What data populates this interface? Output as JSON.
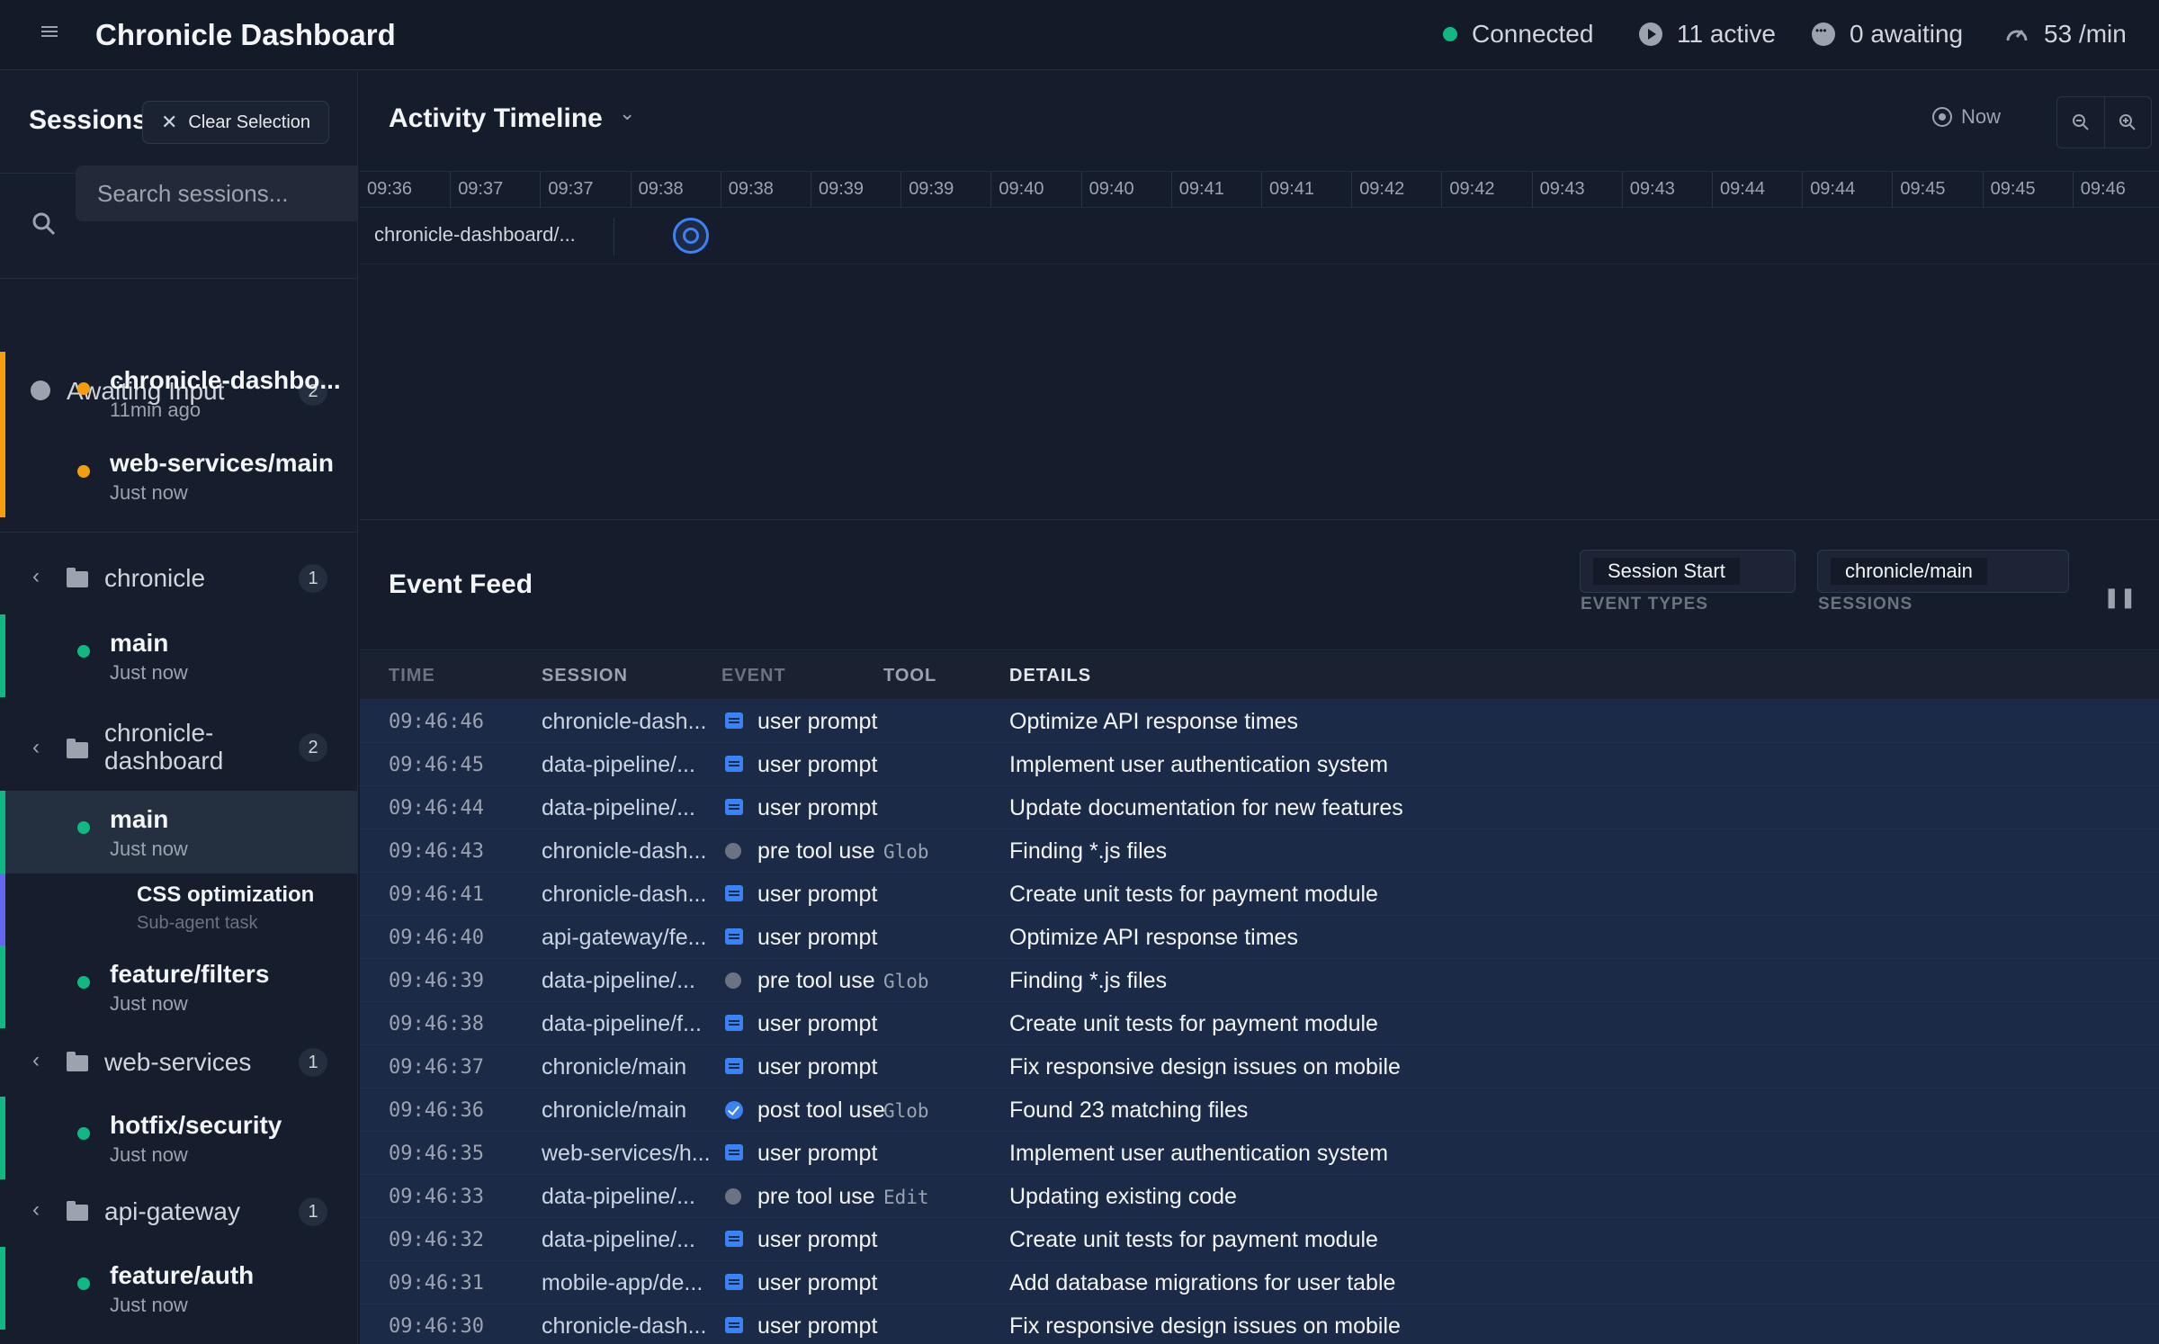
{
  "header": {
    "title": "Chronicle Dashboard",
    "status": "Connected",
    "active": "11 active",
    "awaiting": "0 awaiting",
    "rate": "53 /min"
  },
  "sidebar": {
    "title": "Sessions",
    "clear_label": "Clear Selection",
    "search_placeholder": "Search sessions...",
    "awaiting": {
      "label": "Awaiting Input",
      "count": "2",
      "items": [
        {
          "name": "chronicle-dashbo...",
          "time": "11min ago"
        },
        {
          "name": "web-services/main",
          "time": "Just now"
        }
      ]
    },
    "groups": [
      {
        "name": "chronicle",
        "count": "1",
        "items": [
          {
            "name": "main",
            "time": "Just now"
          }
        ]
      },
      {
        "name_line1": "chronicle-",
        "name_line2": "dashboard",
        "count": "2",
        "items": [
          {
            "name": "main",
            "time": "Just now",
            "sub": {
              "name": "CSS optimization",
              "label": "Sub-agent task"
            }
          },
          {
            "name": "feature/filters",
            "time": "Just now"
          }
        ]
      },
      {
        "name": "web-services",
        "count": "1",
        "items": [
          {
            "name": "hotfix/security",
            "time": "Just now"
          }
        ]
      },
      {
        "name": "api-gateway",
        "count": "1",
        "items": [
          {
            "name": "feature/auth",
            "time": "Just now"
          }
        ]
      }
    ]
  },
  "timeline": {
    "title": "Activity Timeline",
    "now_label": "Now",
    "ticks": [
      "09:36",
      "09:37",
      "09:37",
      "09:38",
      "09:38",
      "09:39",
      "09:39",
      "09:40",
      "09:40",
      "09:41",
      "09:41",
      "09:42",
      "09:42",
      "09:43",
      "09:43",
      "09:44",
      "09:44",
      "09:45",
      "09:45",
      "09:46"
    ],
    "row_label": "chronicle-dashboard/..."
  },
  "feed": {
    "title": "Event Feed",
    "filter_event_value": "Session Start",
    "filter_event_caption": "EVENT TYPES",
    "filter_session_value": "chronicle/main",
    "filter_session_caption": "SESSIONS",
    "pause_icon": "pause-icon",
    "columns": {
      "time": "TIME",
      "session": "SESSION",
      "event": "EVENT",
      "tool": "TOOL",
      "details": "DETAILS"
    },
    "rows": [
      {
        "time": "09:46:46",
        "session": "chronicle-dash...",
        "event_type": "prompt",
        "event": "user prompt",
        "tool": "",
        "details": "Optimize API response times"
      },
      {
        "time": "09:46:45",
        "session": "data-pipeline/...",
        "event_type": "prompt",
        "event": "user prompt",
        "tool": "",
        "details": "Implement user authentication system"
      },
      {
        "time": "09:46:44",
        "session": "data-pipeline/...",
        "event_type": "prompt",
        "event": "user prompt",
        "tool": "",
        "details": "Update documentation for new features"
      },
      {
        "time": "09:46:43",
        "session": "chronicle-dash...",
        "event_type": "pre",
        "event": "pre tool use",
        "tool": "Glob",
        "details": "Finding *.js files"
      },
      {
        "time": "09:46:41",
        "session": "chronicle-dash...",
        "event_type": "prompt",
        "event": "user prompt",
        "tool": "",
        "details": "Create unit tests for payment module"
      },
      {
        "time": "09:46:40",
        "session": "api-gateway/fe...",
        "event_type": "prompt",
        "event": "user prompt",
        "tool": "",
        "details": "Optimize API response times"
      },
      {
        "time": "09:46:39",
        "session": "data-pipeline/...",
        "event_type": "pre",
        "event": "pre tool use",
        "tool": "Glob",
        "details": "Finding *.js files"
      },
      {
        "time": "09:46:38",
        "session": "data-pipeline/f...",
        "event_type": "prompt",
        "event": "user prompt",
        "tool": "",
        "details": "Create unit tests for payment module"
      },
      {
        "time": "09:46:37",
        "session": "chronicle/main",
        "event_type": "prompt",
        "event": "user prompt",
        "tool": "",
        "details": "Fix responsive design issues on mobile"
      },
      {
        "time": "09:46:36",
        "session": "chronicle/main",
        "event_type": "post",
        "event": "post tool use",
        "tool": "Glob",
        "details": "Found 23 matching files"
      },
      {
        "time": "09:46:35",
        "session": "web-services/h...",
        "event_type": "prompt",
        "event": "user prompt",
        "tool": "",
        "details": "Implement user authentication system"
      },
      {
        "time": "09:46:33",
        "session": "data-pipeline/...",
        "event_type": "pre",
        "event": "pre tool use",
        "tool": "Edit",
        "details": "Updating existing code"
      },
      {
        "time": "09:46:32",
        "session": "data-pipeline/...",
        "event_type": "prompt",
        "event": "user prompt",
        "tool": "",
        "details": "Create unit tests for payment module"
      },
      {
        "time": "09:46:31",
        "session": "mobile-app/de...",
        "event_type": "prompt",
        "event": "user prompt",
        "tool": "",
        "details": "Add database migrations for user table"
      },
      {
        "time": "09:46:30",
        "session": "chronicle-dash...",
        "event_type": "prompt",
        "event": "user prompt",
        "tool": "",
        "details": "Fix responsive design issues on mobile"
      }
    ]
  },
  "colors": {
    "awaiting": "#f59e0b",
    "active": "#10b981",
    "subagent": "#6366f1",
    "accent": "#3b82f6"
  }
}
